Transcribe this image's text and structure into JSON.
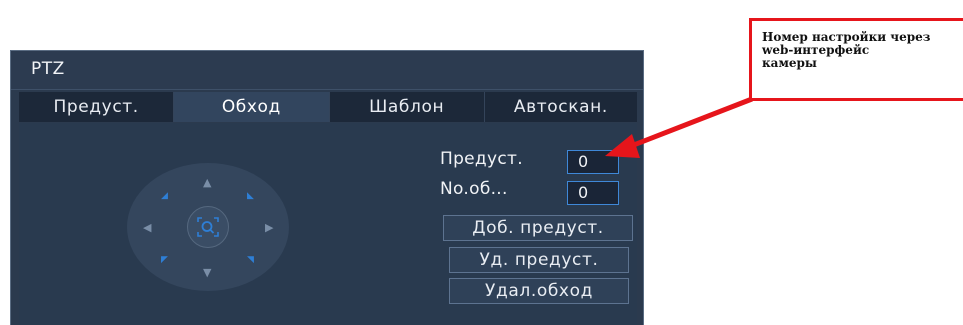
{
  "window": {
    "title": "PTZ"
  },
  "tabs": [
    {
      "label": "Предуст.",
      "active": false
    },
    {
      "label": "Обход",
      "active": true
    },
    {
      "label": "Шаблон",
      "active": false
    },
    {
      "label": "Автоскан.",
      "active": false
    }
  ],
  "fields": {
    "preset_label": "Предуст.",
    "preset_value": "0",
    "tour_label": "No.об...",
    "tour_value": "0"
  },
  "buttons": {
    "add_preset": "Доб. предуст.",
    "delete_preset": "Уд. предуст.",
    "delete_tour": "Удал.обход"
  },
  "callout": {
    "text": "Номер настройки через\nweb-интерфейс\n камеры",
    "border_color": "#e6151b"
  },
  "colors": {
    "window_bg": "#2b3a4e",
    "accent": "#2e7fd6",
    "input_border": "#3f88d8"
  },
  "icons": {
    "ptz_center": "zoom-icon",
    "arrows": [
      "up-arrow-icon",
      "down-arrow-icon",
      "left-arrow-icon",
      "right-arrow-icon"
    ]
  }
}
